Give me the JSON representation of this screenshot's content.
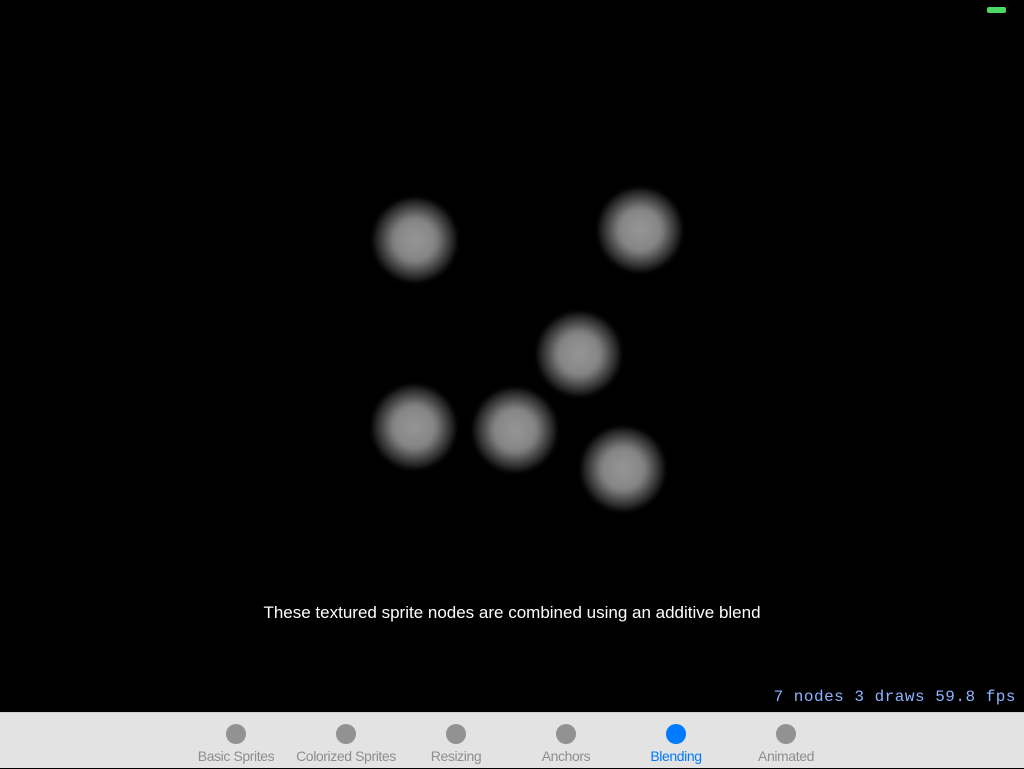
{
  "caption": "These textured sprite nodes are combined using an additive blend",
  "stats": "7 nodes 3 draws 59.8 fps",
  "colors": {
    "accent": "#007aff",
    "inactive": "#929292",
    "stats_text": "#8cb4ff",
    "battery": "#4cd964"
  },
  "tabs": [
    {
      "label": "Basic Sprites",
      "active": false
    },
    {
      "label": "Colorized Sprites",
      "active": false
    },
    {
      "label": "Resizing",
      "active": false
    },
    {
      "label": "Anchors",
      "active": false
    },
    {
      "label": "Blending",
      "active": true
    },
    {
      "label": "Animated",
      "active": false
    }
  ]
}
